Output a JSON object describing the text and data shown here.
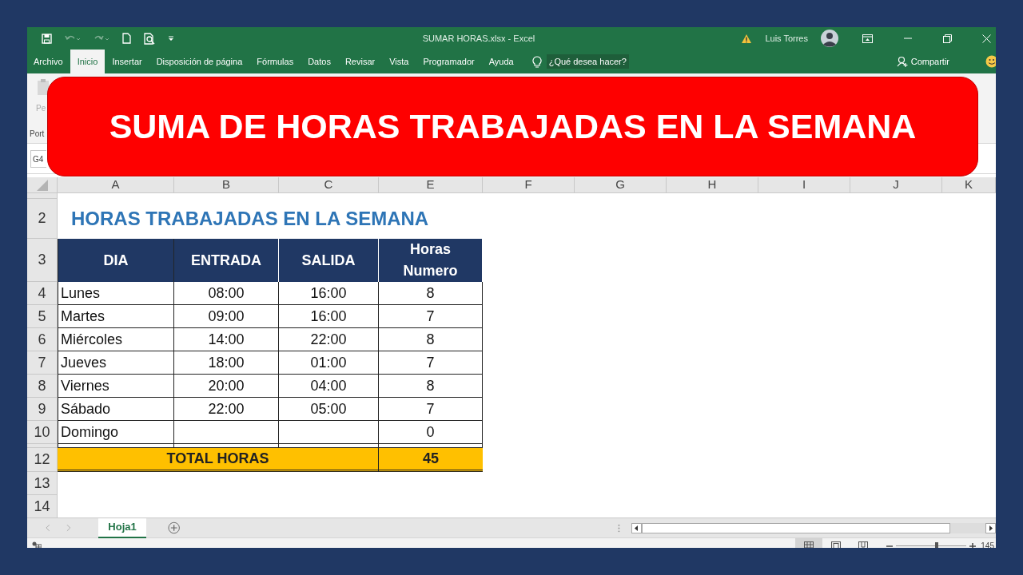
{
  "window": {
    "title": "SUMAR HORAS.xlsx  -  Excel",
    "user": "Luis Torres"
  },
  "ribbon_tabs": [
    {
      "label": "Archivo",
      "selected": false
    },
    {
      "label": "Inicio",
      "selected": true
    },
    {
      "label": "Insertar",
      "selected": false
    },
    {
      "label": "Disposición de página",
      "selected": false
    },
    {
      "label": "Fórmulas",
      "selected": false
    },
    {
      "label": "Datos",
      "selected": false
    },
    {
      "label": "Revisar",
      "selected": false
    },
    {
      "label": "Vista",
      "selected": false
    },
    {
      "label": "Programador",
      "selected": false
    },
    {
      "label": "Ayuda",
      "selected": false
    }
  ],
  "tell_me": {
    "placeholder": "¿Qué desea hacer?"
  },
  "share_button": "Compartir",
  "ribbon": {
    "paste_label": "Pe",
    "group_label": "Port"
  },
  "name_box": "G4",
  "banner": "SUMA DE HORAS TRABAJADAS EN LA SEMANA",
  "sheet": {
    "column_headers": [
      "A",
      "B",
      "C",
      "E",
      "F",
      "G",
      "H",
      "I",
      "J",
      "K"
    ],
    "title_row": {
      "number": "2",
      "text": "HORAS TRABAJADAS EN LA SEMANA"
    },
    "header_row": {
      "number": "3",
      "cells": [
        "DIA",
        "ENTRADA",
        "SALIDA",
        "Horas\nNumero"
      ]
    },
    "data_rows": [
      {
        "number": "4",
        "cells": [
          "Lunes",
          "08:00",
          "16:00",
          "8"
        ]
      },
      {
        "number": "5",
        "cells": [
          "Martes",
          "09:00",
          "16:00",
          "7"
        ]
      },
      {
        "number": "6",
        "cells": [
          "Miércoles",
          "14:00",
          "22:00",
          "8"
        ]
      },
      {
        "number": "7",
        "cells": [
          "Jueves",
          "18:00",
          "01:00",
          "7"
        ]
      },
      {
        "number": "8",
        "cells": [
          "Viernes",
          "20:00",
          "04:00",
          "8"
        ]
      },
      {
        "number": "9",
        "cells": [
          "Sábado",
          "22:00",
          "05:00",
          "7"
        ]
      },
      {
        "number": "10",
        "cells": [
          "Domingo",
          "",
          "",
          "0"
        ]
      }
    ],
    "total_row": {
      "number": "12",
      "label": "TOTAL HORAS",
      "value": "45"
    },
    "empty_rows": [
      {
        "number": "13"
      },
      {
        "number": "14"
      }
    ]
  },
  "sheet_tabs": [
    {
      "label": "Hoja1",
      "selected": true
    }
  ],
  "view_buttons": [
    {
      "kind": "normal",
      "selected": true
    },
    {
      "kind": "layout",
      "selected": false
    },
    {
      "kind": "pagebreak",
      "selected": false
    }
  ],
  "zoom": {
    "level": 0.58,
    "reading": "145"
  }
}
